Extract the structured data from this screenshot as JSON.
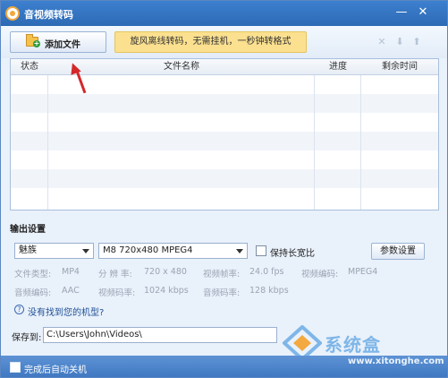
{
  "window": {
    "title": "音视频转码",
    "minimize_glyph": "—",
    "close_glyph": "✕"
  },
  "toolbar": {
    "add_files_label": "添加文件",
    "promo_text": "旋风离线转码，无需挂机，一秒钟转格式",
    "icons": [
      "remove-icon",
      "move-down-icon",
      "move-up-icon"
    ]
  },
  "table": {
    "columns": [
      "状态",
      "文件名称",
      "进度",
      "剩余时间"
    ],
    "rows": []
  },
  "output_settings": {
    "section_title": "输出设置",
    "device_select": "魅族",
    "format_select": "M8 720x480 MPEG4",
    "keep_ratio_label": "保持长宽比",
    "keep_ratio_checked": false,
    "params_button": "参数设置",
    "info": {
      "file_type_label": "文件类型:",
      "file_type_value": "MP4",
      "resolution_label": "分 辨 率:",
      "resolution_value": "720 x 480",
      "frame_rate_label": "视频帧率:",
      "frame_rate_value": "24.0 fps",
      "video_codec_label": "视频编码:",
      "video_codec_value": "MPEG4",
      "audio_codec_label": "音频编码:",
      "audio_codec_value": "AAC",
      "video_bitrate_label": "视频码率:",
      "video_bitrate_value": "1024 kbps",
      "audio_bitrate_label": "音频码率:",
      "audio_bitrate_value": "128 kbps"
    },
    "help_link": "没有找到您的机型?"
  },
  "save": {
    "label": "保存到:",
    "path": "C:\\Users\\John\\Videos\\"
  },
  "footer": {
    "shutdown_label": "完成后自动关机",
    "shutdown_checked": false
  },
  "watermark": {
    "text": "系统盒",
    "url": "www.xitonghe.com"
  },
  "colors": {
    "titlebar": "#2d6ab5",
    "promo_bg": "#fbe08f",
    "arrow": "#d4282a",
    "footer": "#3d76c0"
  }
}
